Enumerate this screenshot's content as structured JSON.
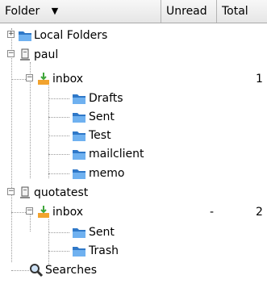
{
  "header": {
    "folder_label": "Folder",
    "unread_label": "Unread",
    "total_label": "Total"
  },
  "tree": {
    "local_folders": {
      "label": "Local Folders",
      "icon": "folder-icon"
    },
    "paul": {
      "label": "paul",
      "icon": "mail-server-icon",
      "inbox": {
        "label": "inbox",
        "unread": "",
        "total": "1",
        "icon": "inbox-icon"
      },
      "children": [
        "Drafts",
        "Sent",
        "Test",
        "mailclient",
        "memo"
      ]
    },
    "quotatest": {
      "label": "quotatest",
      "icon": "mail-server-icon",
      "inbox": {
        "label": "inbox",
        "unread": "-",
        "total": "2",
        "icon": "inbox-icon"
      },
      "children": [
        "Sent",
        "Trash"
      ]
    },
    "searches": {
      "label": "Searches",
      "icon": "search-icon"
    }
  },
  "colors": {
    "folder_blue": "#3a86d6",
    "inbox_orange": "#f2a32e",
    "inbox_green": "#3fa63a",
    "header_border": "#a9a9a9"
  }
}
